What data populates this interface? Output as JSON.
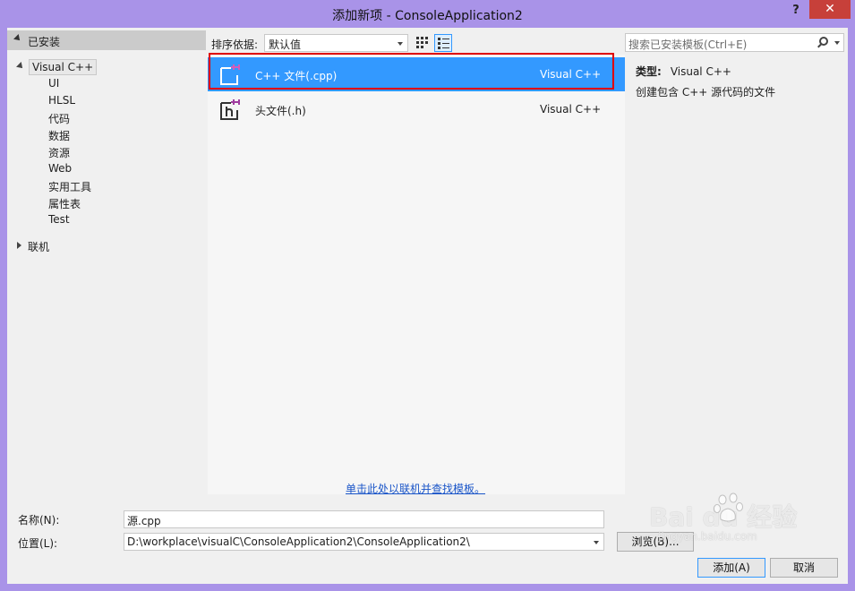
{
  "window": {
    "title": "添加新项 - ConsoleApplication2",
    "help": "?",
    "close": "✕"
  },
  "tree": {
    "installed": "已安装",
    "visual_cpp": "Visual C++",
    "children": [
      "UI",
      "HLSL",
      "代码",
      "数据",
      "资源",
      "Web",
      "实用工具",
      "属性表",
      "Test"
    ],
    "online": "联机"
  },
  "toolbar": {
    "sort_label": "排序依据:",
    "sort_value": "默认值",
    "search_placeholder": "搜索已安装模板(Ctrl+E)"
  },
  "templates": [
    {
      "name": "C++ 文件(.cpp)",
      "lang": "Visual C++",
      "icon": "cpp-file-icon",
      "selected": true
    },
    {
      "name": "头文件(.h)",
      "lang": "Visual C++",
      "icon": "header-file-icon",
      "selected": false
    }
  ],
  "details": {
    "type_label": "类型:",
    "type_value": "Visual C++",
    "description": "创建包含 C++ 源代码的文件"
  },
  "online_link": "单击此处以联机并查找模板。",
  "form": {
    "name_label": "名称(N):",
    "name_value": "源.cpp",
    "location_label": "位置(L):",
    "location_value": "D:\\workplace\\visualC\\ConsoleApplication2\\ConsoleApplication2\\",
    "browse": "浏览(B)...",
    "add": "添加(A)",
    "cancel": "取消"
  },
  "watermark": {
    "brand": "Bai  du 经验",
    "url": "jingyan.baidu.com"
  },
  "colors": {
    "frame": "#a993e8",
    "selection": "#3399ff",
    "highlight_box": "#e00000",
    "close": "#c7403a"
  }
}
